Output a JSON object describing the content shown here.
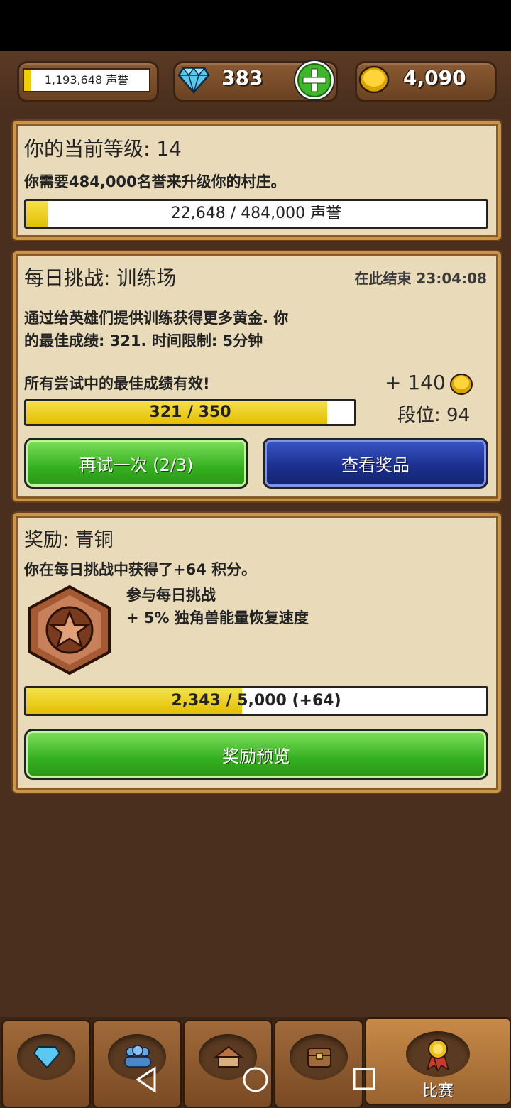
{
  "topbar": {
    "prestige": "1,193,648 声誉",
    "prestige_progress": 0.05,
    "gems": "383",
    "gold": "4,090",
    "gem_icon": "diamond-icon",
    "add_icon": "plus-icon",
    "gold_icon": "gold-coin-icon"
  },
  "level_panel": {
    "title": "你的当前等级: 14",
    "description": "你需要484,000名誉来升级你的村庄。",
    "progress_text": "22,648 / 484,000 声誉",
    "progress": 0.047
  },
  "challenge_panel": {
    "title": "每日挑战: 训练场",
    "ends": "在此结束 23:04:08",
    "desc_line1": "通过给英雄们提供训练获得更多黄金. 你",
    "desc_line2": "的最佳成绩: 321. 时间限制: 5分钟",
    "note": "所有尝试中的最佳成绩有效!",
    "reward_gold": "+ 140",
    "rank": "段位: 94",
    "progress_text": "321 / 350",
    "progress": 0.917,
    "retry_button": "再试一次 (2/3)",
    "prizes_button": "查看奖品"
  },
  "reward_panel": {
    "title": "奖励: 青铜",
    "earned": "你在每日挑战中获得了+64 积分。",
    "perk1": "参与每日挑战",
    "perk2": "+ 5% 独角兽能量恢复速度",
    "progress_text": "2,343 / 5,000 (+64)",
    "progress": 0.4686,
    "preview_button": "奖励预览",
    "medal_icon": "bronze-medal-icon"
  },
  "navbar": {
    "items": [
      {
        "icon": "diamond-icon"
      },
      {
        "icon": "heroes-icon"
      },
      {
        "icon": "village-icon"
      },
      {
        "icon": "chest-icon"
      },
      {
        "icon": "medal-icon",
        "label": "比赛"
      }
    ]
  },
  "colors": {
    "background": "#4a2f1e",
    "panel": "#e9dbba",
    "progress_yellow": "#f2d000",
    "button_green": "#34b020",
    "button_blue": "#1a2e8c"
  }
}
